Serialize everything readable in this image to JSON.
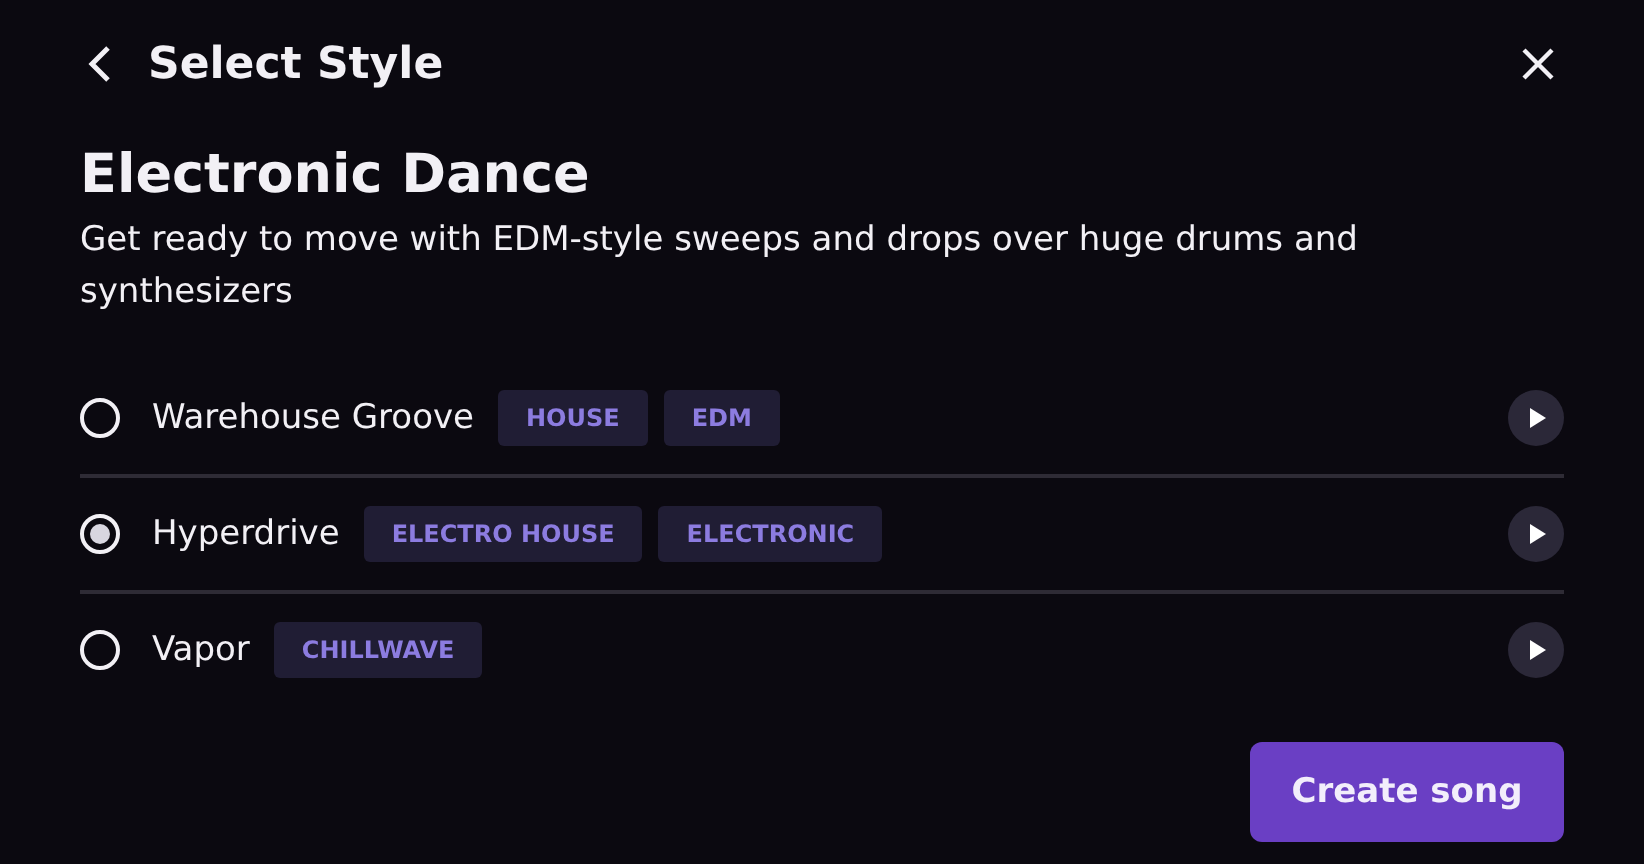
{
  "header": {
    "title": "Select Style"
  },
  "genre": {
    "title": "Electronic Dance",
    "description": "Get ready to move with EDM-style sweeps and drops over huge drums and synthesizers"
  },
  "styles": [
    {
      "name": "Warehouse Groove",
      "selected": false,
      "tags": [
        "HOUSE",
        "EDM"
      ]
    },
    {
      "name": "Hyperdrive",
      "selected": true,
      "tags": [
        "ELECTRO HOUSE",
        "ELECTRONIC"
      ]
    },
    {
      "name": "Vapor",
      "selected": false,
      "tags": [
        "CHILLWAVE"
      ]
    }
  ],
  "action": {
    "label": "Create song"
  }
}
